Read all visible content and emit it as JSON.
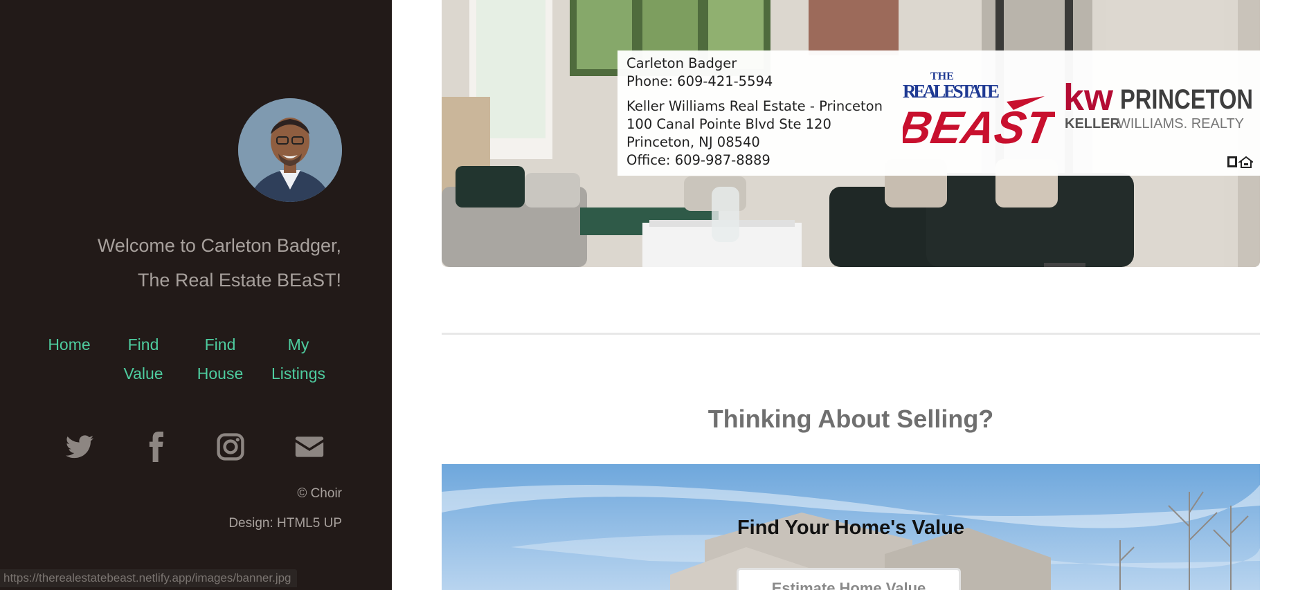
{
  "sidebar": {
    "welcome_line1": "Welcome to Carleton Badger,",
    "welcome_line2": "The Real Estate BEaST!",
    "nav": [
      {
        "line1": "Home",
        "line2": ""
      },
      {
        "line1": "Find",
        "line2": "Value"
      },
      {
        "line1": "Find",
        "line2": "House"
      },
      {
        "line1": "My",
        "line2": "Listings"
      }
    ],
    "social_icons": [
      "twitter-icon",
      "facebook-icon",
      "instagram-icon",
      "envelope-icon"
    ],
    "copyright": "© Choir",
    "design_credit": "Design: HTML5 UP"
  },
  "status_bar": {
    "url": "https://therealestatebeast.netlify.app/images/banner.jpg"
  },
  "banner": {
    "name": "Carleton Badger",
    "phone": "Phone: 609-421-5594",
    "company": "Keller Williams Real Estate - Princeton",
    "address1": "100 Canal Pointe Blvd Ste 120",
    "address2": "Princeton, NJ 08540",
    "office": "Office: 609-987-8889",
    "logo_beast_top": "THE",
    "logo_beast_mid": "REAL ESTATE",
    "logo_beast_main": "BEAST",
    "logo_kw": "kw",
    "logo_princeton": "PRINCETON",
    "logo_keller": "KELLER",
    "logo_williams": "WILLIAMS. REALTY"
  },
  "main": {
    "section_title": "Thinking About Selling?",
    "value_title": "Find Your Home's Value",
    "estimate_button": "Estimate Home Value"
  },
  "colors": {
    "sidebar_bg": "#221a18",
    "nav_link": "#4ecc9f",
    "sidebar_text": "#a7a09c",
    "beast_red": "#c8102e",
    "kw_red": "#b40c34"
  }
}
